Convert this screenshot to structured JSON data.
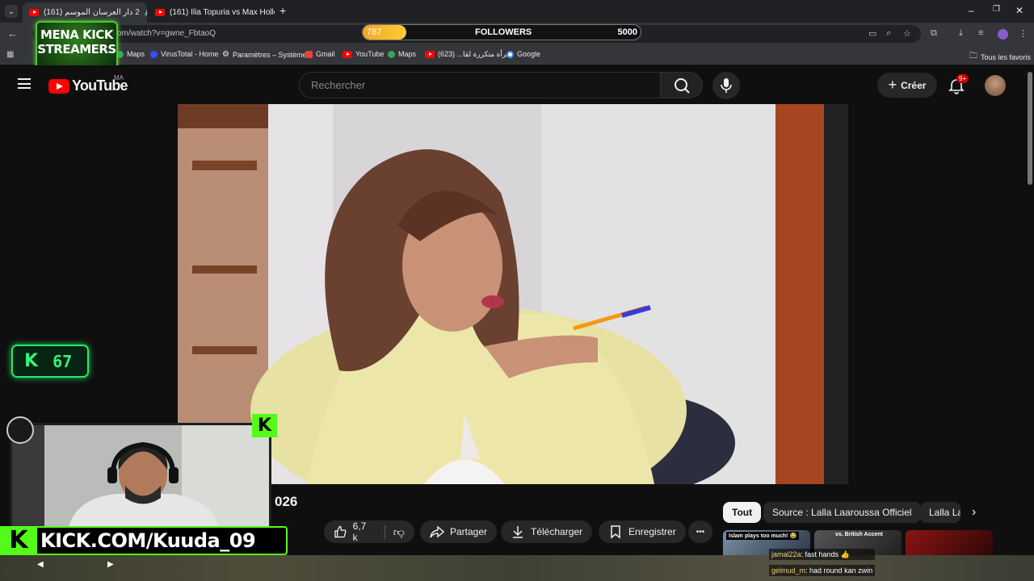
{
  "browser": {
    "tabs": [
      {
        "label": "2 دار العرسان الموسم (161)",
        "active": true
      },
      {
        "label": "(161) Ilia Topuria vs Max Hollow",
        "active": false
      }
    ],
    "new_tab_symbol": "+",
    "url": "om/watch?v=gwne_FbtaoQ",
    "bookmarks": [
      {
        "label": "Maps",
        "color": "#34a853"
      },
      {
        "label": "VirusTotal - Home",
        "color": "#394eff"
      },
      {
        "label": "Paramètres – Système",
        "color": "#9aa0a6"
      },
      {
        "label": "Gmail",
        "color": "#ea4335"
      },
      {
        "label": "YouTube",
        "color": "#ff0000"
      },
      {
        "label": "Maps",
        "color": "#34a853"
      },
      {
        "label": "إمرأة متكررة لقا... (623)",
        "color": "#ff0000"
      },
      {
        "label": "Google",
        "color": "#ffffff"
      }
    ],
    "all_bookmarks": "Tous les favoris"
  },
  "followers": {
    "current": "787",
    "label": "FOLLOWERS",
    "goal": "5000",
    "progress": 0.157
  },
  "mena_logo": {
    "line1": "MENA KICK",
    "line2": "STREAMERS"
  },
  "youtube": {
    "brand": "YouTube",
    "region": "MA",
    "search_placeholder": "Rechercher",
    "create_label": "Créer",
    "notif_badge": "9+"
  },
  "video": {
    "title_tail": "026",
    "like_count": "6,7 k",
    "share_label": "Partager",
    "download_label": "Télécharger",
    "save_label": "Enregistrer",
    "more_label": "•••"
  },
  "chips": {
    "all": "Tout",
    "source": "Source : Lalla Laaroussa Officiel",
    "partial": "Lalla La"
  },
  "recommended": {
    "thumb1_caption": "Islam plays too much! 😂",
    "thumb2_caption": "vs. British Accent"
  },
  "stream": {
    "k_count": "67",
    "kick_banner": "KICK.COM/Kuuda_09",
    "accent": "#53fc18",
    "chat": [
      {
        "user": "jamal22a",
        "text": ": fast hands 👍"
      },
      {
        "user": "gelmud_m",
        "text": ": had round kan zwin"
      }
    ]
  }
}
